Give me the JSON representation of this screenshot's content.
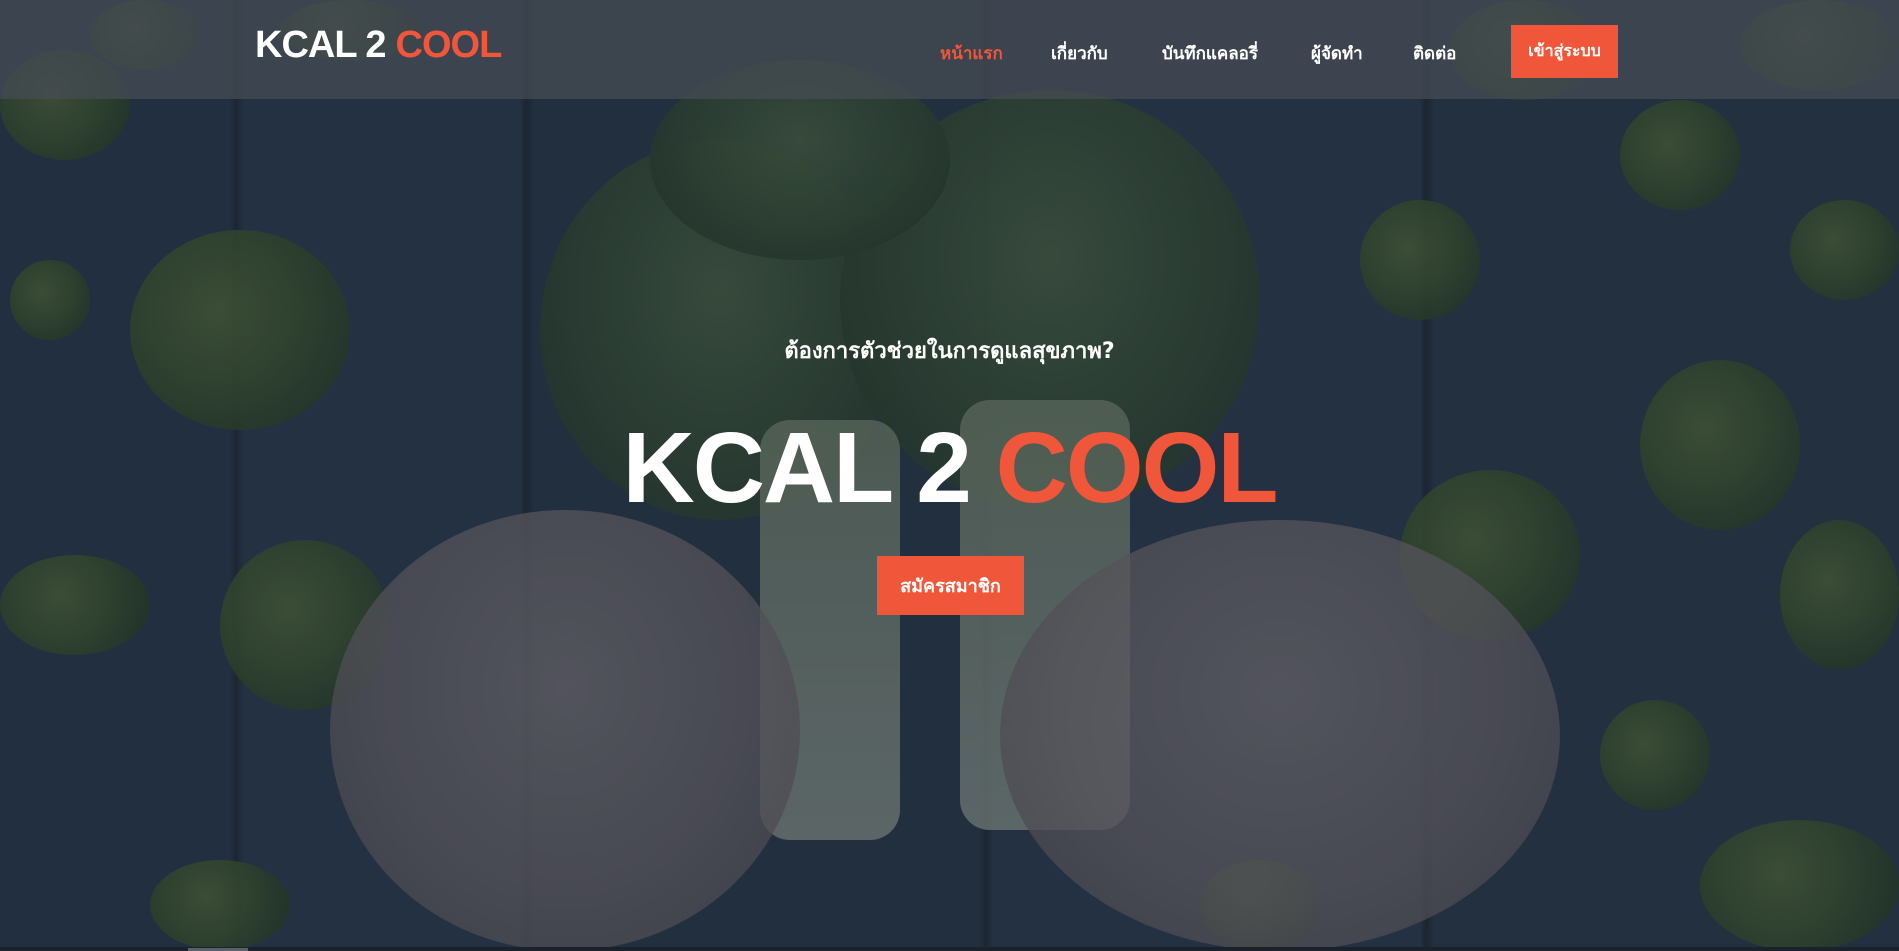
{
  "brand": {
    "name_part1": "KCAL 2",
    "name_part2": "COOL",
    "accent_color": "#f0563a"
  },
  "nav": {
    "items": [
      {
        "label": "หน้าแรก",
        "active": true
      },
      {
        "label": "เกี่ยวกับ",
        "active": false
      },
      {
        "label": "บันทึกแคลอรี่",
        "active": false
      },
      {
        "label": "ผู้จัดทำ",
        "active": false
      },
      {
        "label": "ติดต่อ",
        "active": false
      }
    ],
    "login_label": "เข้าสู่ระบบ"
  },
  "hero": {
    "tagline": "ต้องการตัวช่วยในการดูแลสุขภาพ?",
    "title_part1": "KCAL 2",
    "title_part2": "COOL",
    "signup_label": "สมัครสมาชิก"
  }
}
